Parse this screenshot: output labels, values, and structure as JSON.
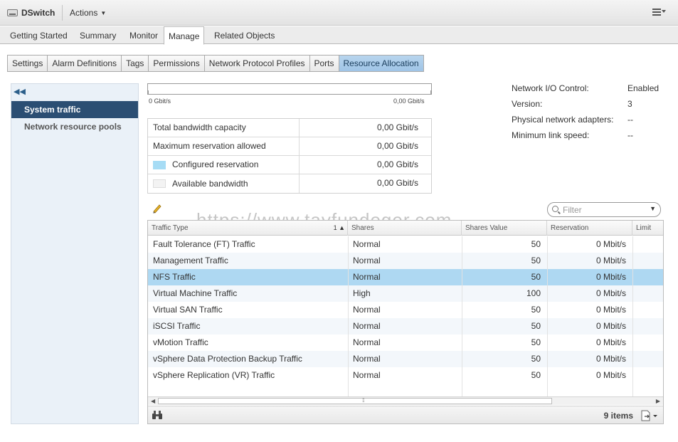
{
  "titlebar": {
    "title": "DSwitch",
    "actions_label": "Actions"
  },
  "main_tabs": [
    {
      "label": "Getting Started"
    },
    {
      "label": "Summary"
    },
    {
      "label": "Monitor"
    },
    {
      "label": "Manage",
      "active": true
    },
    {
      "label": "Related Objects"
    }
  ],
  "sub_tabs": [
    {
      "label": "Settings"
    },
    {
      "label": "Alarm Definitions"
    },
    {
      "label": "Tags"
    },
    {
      "label": "Permissions"
    },
    {
      "label": "Network Protocol Profiles"
    },
    {
      "label": "Ports"
    },
    {
      "label": "Resource Allocation",
      "active": true
    }
  ],
  "sidebar": {
    "collapse_icon": "double-chevron-left-icon",
    "items": [
      {
        "label": "System traffic",
        "active": true
      },
      {
        "label": "Network resource pools"
      }
    ]
  },
  "bandwidth_bar": {
    "min_label": "0 Gbit/s",
    "max_label": "0,00 Gbit/s"
  },
  "capacity": [
    {
      "label": "Total bandwidth capacity",
      "value": "0,00 Gbit/s"
    },
    {
      "label": "Maximum reservation allowed",
      "value": "0,00 Gbit/s"
    },
    {
      "label": "Configured reservation",
      "value": "0,00 Gbit/s",
      "swatch": "#a6dcf5"
    },
    {
      "label": "Available bandwidth",
      "value": "0,00 Gbit/s",
      "swatch": "#f3f3f3"
    }
  ],
  "info": [
    {
      "label": "Network I/O Control:",
      "value": "Enabled"
    },
    {
      "label": "Version:",
      "value": "3"
    },
    {
      "label": "Physical network adapters:",
      "value": "--"
    },
    {
      "label": "Minimum link speed:",
      "value": "--"
    }
  ],
  "filter": {
    "placeholder": "Filter"
  },
  "watermark": "https://www.tayfundeger.com",
  "table": {
    "columns": [
      "Traffic Type",
      "Shares",
      "Shares Value",
      "Reservation",
      "Limit"
    ],
    "sort_indicator": "1 ▲",
    "rows": [
      {
        "type": "Fault Tolerance (FT) Traffic",
        "shares": "Normal",
        "value": "50",
        "reservation": "0 Mbit/s"
      },
      {
        "type": "Management Traffic",
        "shares": "Normal",
        "value": "50",
        "reservation": "0 Mbit/s"
      },
      {
        "type": "NFS Traffic",
        "shares": "Normal",
        "value": "50",
        "reservation": "0 Mbit/s",
        "selected": true
      },
      {
        "type": "Virtual Machine Traffic",
        "shares": "High",
        "value": "100",
        "reservation": "0 Mbit/s"
      },
      {
        "type": "Virtual SAN Traffic",
        "shares": "Normal",
        "value": "50",
        "reservation": "0 Mbit/s"
      },
      {
        "type": "iSCSI Traffic",
        "shares": "Normal",
        "value": "50",
        "reservation": "0 Mbit/s"
      },
      {
        "type": "vMotion Traffic",
        "shares": "Normal",
        "value": "50",
        "reservation": "0 Mbit/s"
      },
      {
        "type": "vSphere Data Protection Backup Traffic",
        "shares": "Normal",
        "value": "50",
        "reservation": "0 Mbit/s"
      },
      {
        "type": "vSphere Replication (VR) Traffic",
        "shares": "Normal",
        "value": "50",
        "reservation": "0 Mbit/s"
      }
    ],
    "item_count": "9 items"
  }
}
